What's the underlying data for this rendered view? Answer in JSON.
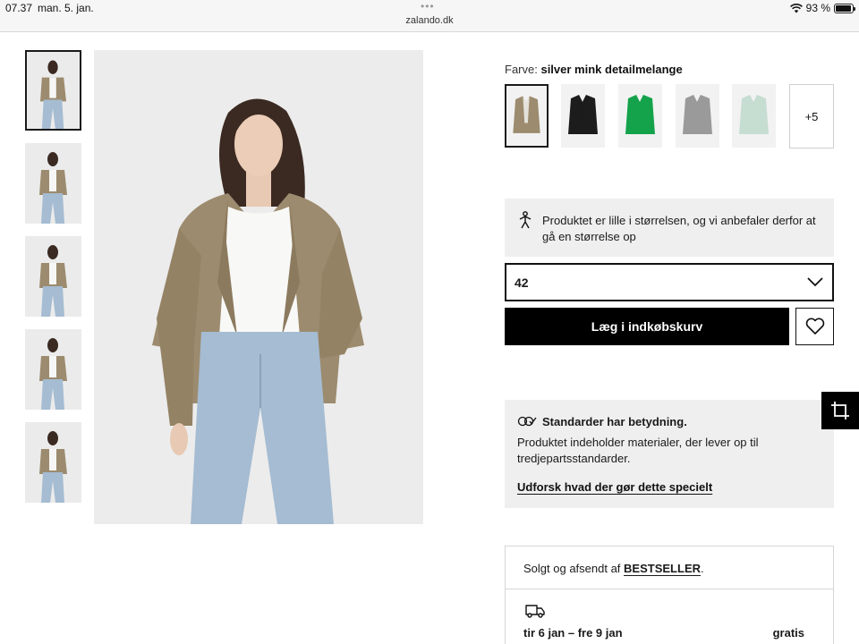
{
  "status_bar": {
    "time": "07.37",
    "date": "man. 5. jan.",
    "dots": "•••",
    "url": "zalando.dk",
    "battery": "93 %",
    "battery_level": 0.93
  },
  "gallery": {
    "thumbnails": [
      {
        "name": "front",
        "selected": true
      },
      {
        "name": "full-body",
        "selected": false
      },
      {
        "name": "back",
        "selected": false
      },
      {
        "name": "detail",
        "selected": false
      },
      {
        "name": "walking",
        "selected": false
      }
    ]
  },
  "product": {
    "color_prefix": "Farve:",
    "color_name": "silver mink detailmelange",
    "swatches": [
      {
        "color": "#9c8b6e",
        "selected": true
      },
      {
        "color": "#1c1c1c",
        "selected": false
      },
      {
        "color": "#14a24b",
        "selected": false
      },
      {
        "color": "#9a9a9a",
        "selected": false
      },
      {
        "color": "#c6ddd2",
        "selected": false
      }
    ],
    "more_colors": "+5",
    "fit_advice": "Produktet er lille i størrelsen, og vi anbefaler derfor at gå en størrelse op",
    "selected_size": "42",
    "add_to_cart": "Læg i indkøbskurv"
  },
  "standards": {
    "title": "Standarder har betydning.",
    "text": "Produktet indeholder materialer, der lever op til tredjepartsstandarder.",
    "link": "Udforsk hvad der gør dette specielt"
  },
  "seller": {
    "prefix": "Solgt og afsendt af",
    "name": "BESTSELLER",
    "suffix": "."
  },
  "delivery": {
    "dates": "tir 6 jan – fre 9 jan",
    "price": "gratis"
  }
}
